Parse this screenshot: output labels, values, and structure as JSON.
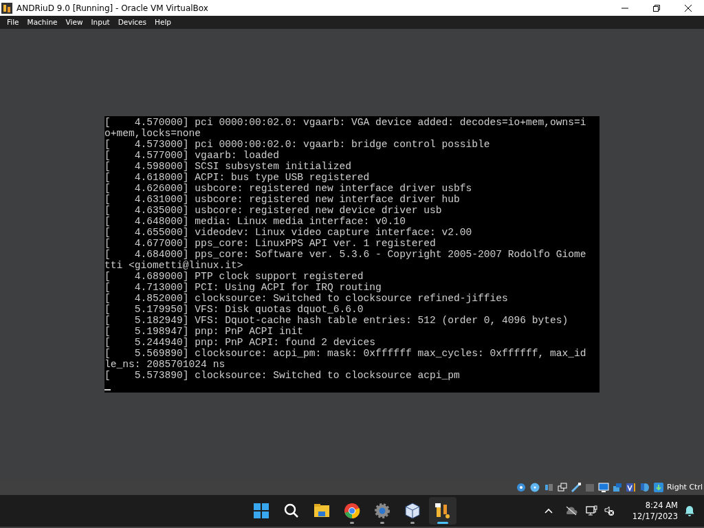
{
  "window": {
    "title": "ANDRiuD 9.0 [Running] - Oracle VM VirtualBox"
  },
  "menu": [
    "File",
    "Machine",
    "View",
    "Input",
    "Devices",
    "Help"
  ],
  "console_lines": [
    "[    4.570000] pci 0000:00:02.0: vgaarb: VGA device added: decodes=io+mem,owns=i",
    "o+mem,locks=none",
    "[    4.573000] pci 0000:00:02.0: vgaarb: bridge control possible",
    "[    4.577000] vgaarb: loaded",
    "[    4.598000] SCSI subsystem initialized",
    "[    4.618000] ACPI: bus type USB registered",
    "[    4.626000] usbcore: registered new interface driver usbfs",
    "[    4.631000] usbcore: registered new interface driver hub",
    "[    4.635000] usbcore: registered new device driver usb",
    "[    4.648000] media: Linux media interface: v0.10",
    "[    4.655000] videodev: Linux video capture interface: v2.00",
    "[    4.677000] pps_core: LinuxPPS API ver. 1 registered",
    "[    4.684000] pps_core: Software ver. 5.3.6 - Copyright 2005-2007 Rodolfo Giome",
    "tti <giometti@linux.it>",
    "[    4.689000] PTP clock support registered",
    "[    4.713000] PCI: Using ACPI for IRQ routing",
    "[    4.852000] clocksource: Switched to clocksource refined-jiffies",
    "[    5.179950] VFS: Disk quotas dquot_6.6.0",
    "[    5.182949] VFS: Dquot-cache hash table entries: 512 (order 0, 4096 bytes)",
    "[    5.198947] pnp: PnP ACPI init",
    "[    5.244940] pnp: PnP ACPI: found 2 devices",
    "[    5.569890] clocksource: acpi_pm: mask: 0xffffff max_cycles: 0xffffff, max_id",
    "le_ns: 2085701024 ns",
    "[    5.573890] clocksource: Switched to clocksource acpi_pm"
  ],
  "status_bar": {
    "host_key": "Right Ctrl"
  },
  "taskbar": [
    {
      "kind": "start",
      "running": false,
      "selected": false
    },
    {
      "kind": "search",
      "running": false,
      "selected": false
    },
    {
      "kind": "folder",
      "running": false,
      "selected": false
    },
    {
      "kind": "browser",
      "running": true,
      "selected": false
    },
    {
      "kind": "gear",
      "running": true,
      "selected": false
    },
    {
      "kind": "cube",
      "running": true,
      "selected": false
    },
    {
      "kind": "app",
      "running": true,
      "selected": true
    }
  ],
  "clock": {
    "time": "8:24 AM",
    "date": "12/17/2023"
  }
}
